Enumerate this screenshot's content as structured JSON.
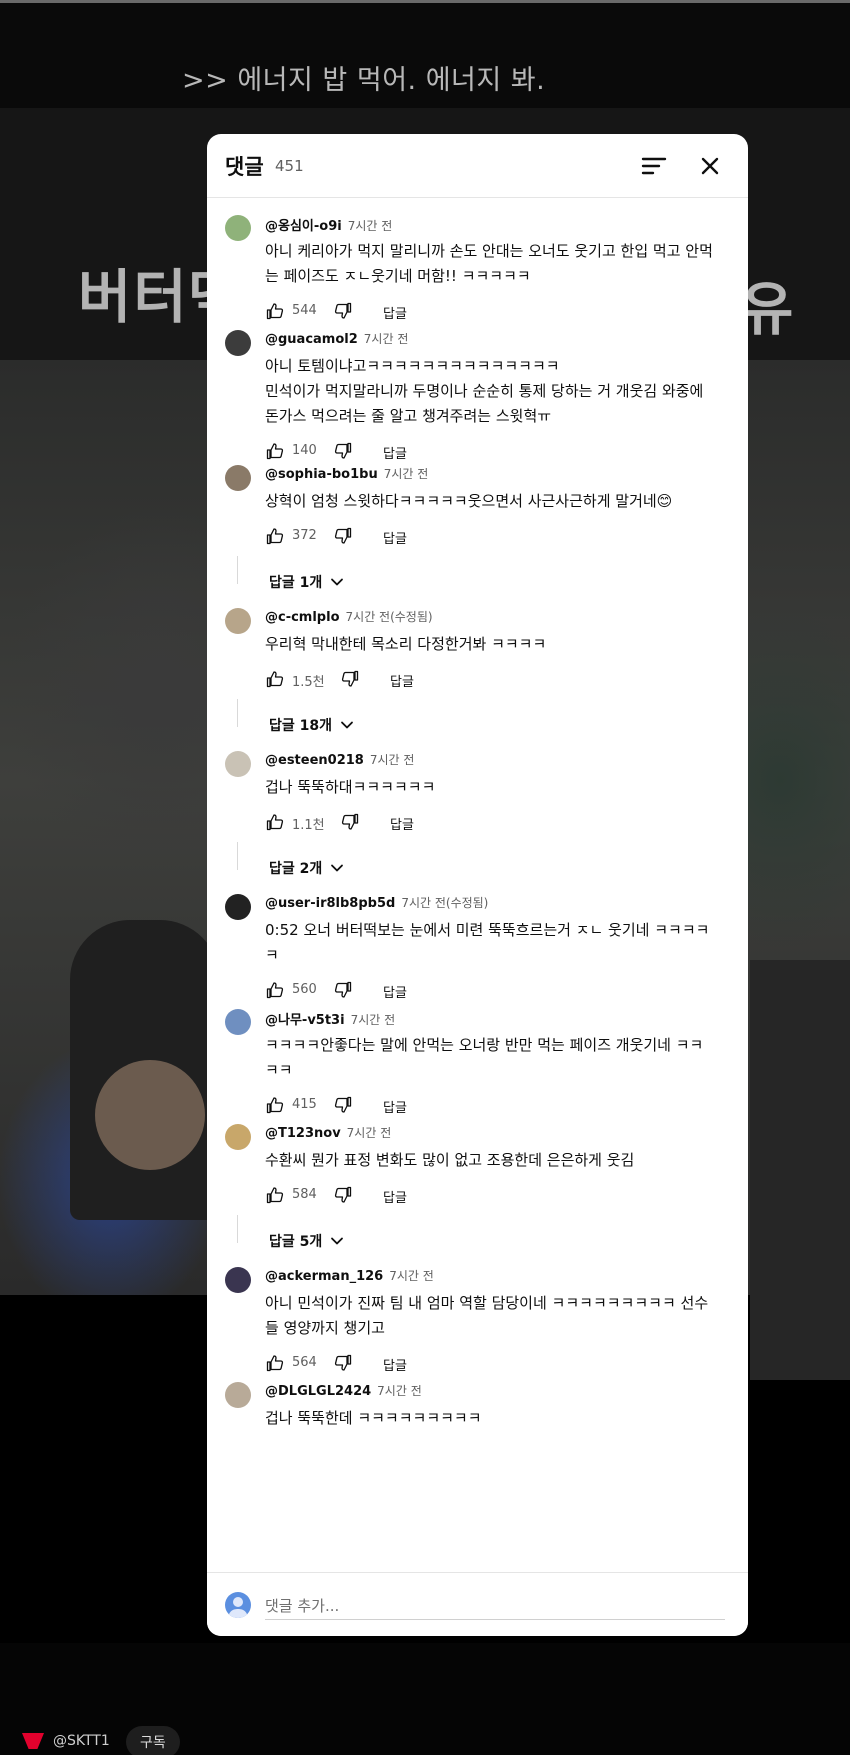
{
  "video": {
    "caption": ">> 에너지 밥 먹어. 에너지 봐.",
    "title_left": "버터떡",
    "title_right": "유",
    "channel": "@SKTT1",
    "subscribe_label": "구독"
  },
  "panel": {
    "title": "댓글",
    "count": "451",
    "add_comment_placeholder": "댓글 추가..."
  },
  "reply_label": "답글",
  "comments": [
    {
      "author": "@옹심이-o9i",
      "time": "7시간 전",
      "text": "아니 케리아가 먹지 말리니까 손도 안대는 오너도 웃기고 한입 먹고 안먹\n는 페이즈도 ㅈㄴ웃기네 머함!! ㅋㅋㅋㅋㅋ",
      "likes": "544"
    },
    {
      "author": "@guacamol2",
      "time": "7시간 전",
      "text": "아니 토템이냐고ㅋㅋㅋㅋㅋㅋㅋㅋㅋㅋㅋㅋㅋㅋ\n민석이가 먹지말라니까 두명이나 순순히 통제 당하는 거 개웃김 와중에\n돈가스 먹으려는 줄 알고 챙겨주려는 스윗혁ㅠ",
      "likes": "140"
    },
    {
      "author": "@sophia-bo1bu",
      "time": "7시간 전",
      "text": "상혁이 엄청 스윗하다ㅋㅋㅋㅋㅋ웃으면서 사근사근하게 말거네😊",
      "likes": "372",
      "replies": "답글 1개"
    },
    {
      "author": "@c-cmlplo",
      "time": "7시간 전(수정됨)",
      "text": "우리혁 막내한테 목소리 다정한거봐 ㅋㅋㅋㅋ",
      "likes": "1.5천",
      "replies": "답글 18개"
    },
    {
      "author": "@esteen0218",
      "time": "7시간 전",
      "text": "겁나 뚝뚝하대ㅋㅋㅋㅋㅋㅋ",
      "likes": "1.1천",
      "replies": "답글 2개"
    },
    {
      "author": "@user-ir8lb8pb5d",
      "time": "7시간 전(수정됨)",
      "text": "0:52 오너 버터떡보는 눈에서 미련 뚝뚝흐르는거 ㅈㄴ 웃기네 ㅋㅋㅋㅋ\nㅋ",
      "likes": "560"
    },
    {
      "author": "@나무-v5t3i",
      "time": "7시간 전",
      "text": "ㅋㅋㅋㅋ안좋다는 말에 안먹는 오너랑 반만 먹는 페이즈 개웃기네 ㅋㅋ\nㅋㅋ",
      "likes": "415"
    },
    {
      "author": "@T123nov",
      "time": "7시간 전",
      "text": "수환씨 뭔가 표정 변화도 많이 없고 조용한데 은은하게 웃김",
      "likes": "584",
      "replies": "답글 5개"
    },
    {
      "author": "@ackerman_126",
      "time": "7시간 전",
      "text": "아니 민석이가 진짜 팀 내 엄마 역할 담당이네 ㅋㅋㅋㅋㅋㅋㅋㅋㅋ 선수\n들 영양까지 챙기고",
      "likes": "564"
    },
    {
      "author": "@DLGLGL2424",
      "time": "7시간 전",
      "text": "겁나 뚝뚝한데 ㅋㅋㅋㅋㅋㅋㅋㅋㅋ"
    }
  ],
  "colors": {
    "panel_bg": "#ffffff",
    "text": "#0f0f0f",
    "muted": "#606060",
    "brand": "#e2012d"
  }
}
